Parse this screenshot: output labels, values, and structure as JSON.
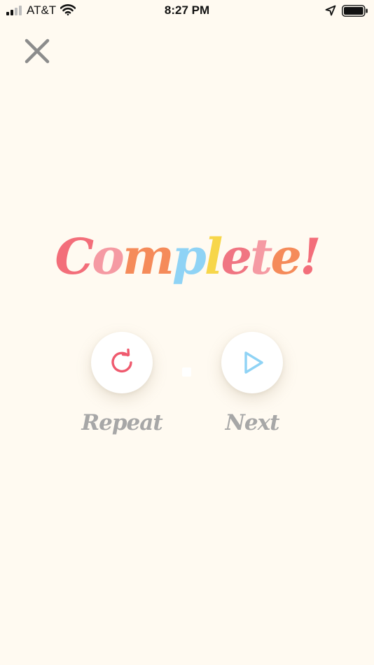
{
  "status_bar": {
    "carrier": "AT&T",
    "time": "8:27 PM"
  },
  "icons": {
    "close": "close-icon",
    "repeat": "refresh-icon",
    "next": "play-icon"
  },
  "title": {
    "letters": [
      {
        "char": "C",
        "color": "#F36E7A"
      },
      {
        "char": "o",
        "color": "#F59AA3"
      },
      {
        "char": "m",
        "color": "#F58B5A"
      },
      {
        "char": "p",
        "color": "#8FD3F5"
      },
      {
        "char": "l",
        "color": "#F7D64A"
      },
      {
        "char": "e",
        "color": "#F07582"
      },
      {
        "char": "t",
        "color": "#F59AA3"
      },
      {
        "char": "e",
        "color": "#F58B5A"
      },
      {
        "char": "!",
        "color": "#F36E7A"
      }
    ]
  },
  "actions": {
    "repeat_label": "Repeat",
    "next_label": "Next",
    "repeat_color": "#EF5A6E",
    "next_color": "#8FD3F5"
  },
  "colors": {
    "background": "#FFFAF1",
    "label_gray": "#A7A7A7",
    "close_gray": "#8C8C8C"
  }
}
